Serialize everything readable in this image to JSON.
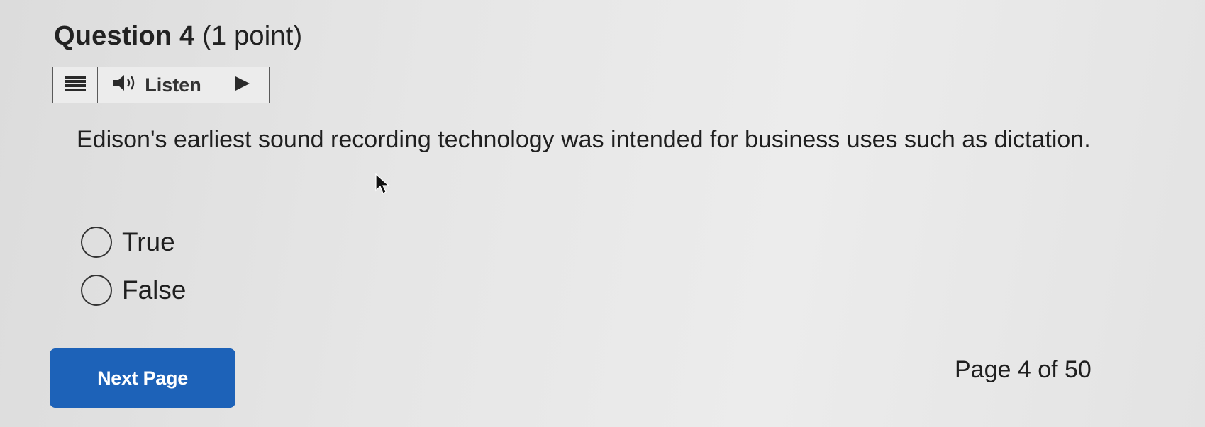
{
  "question": {
    "title": "Question 4",
    "points": "(1 point)",
    "text": "Edison's earliest sound recording technology was intended for business uses such as dictation."
  },
  "listen_bar": {
    "menu_icon": "menu-icon",
    "speaker_icon": "speaker-icon",
    "label": "Listen",
    "play_icon": "play-icon"
  },
  "options": [
    {
      "label": "True",
      "selected": false
    },
    {
      "label": "False",
      "selected": false
    }
  ],
  "navigation": {
    "next_label": "Next Page",
    "page_indicator": "Page 4 of 50"
  },
  "colors": {
    "primary_button": "#1d62b8",
    "background": "#e6e6e6",
    "text": "#1f1f1f"
  }
}
